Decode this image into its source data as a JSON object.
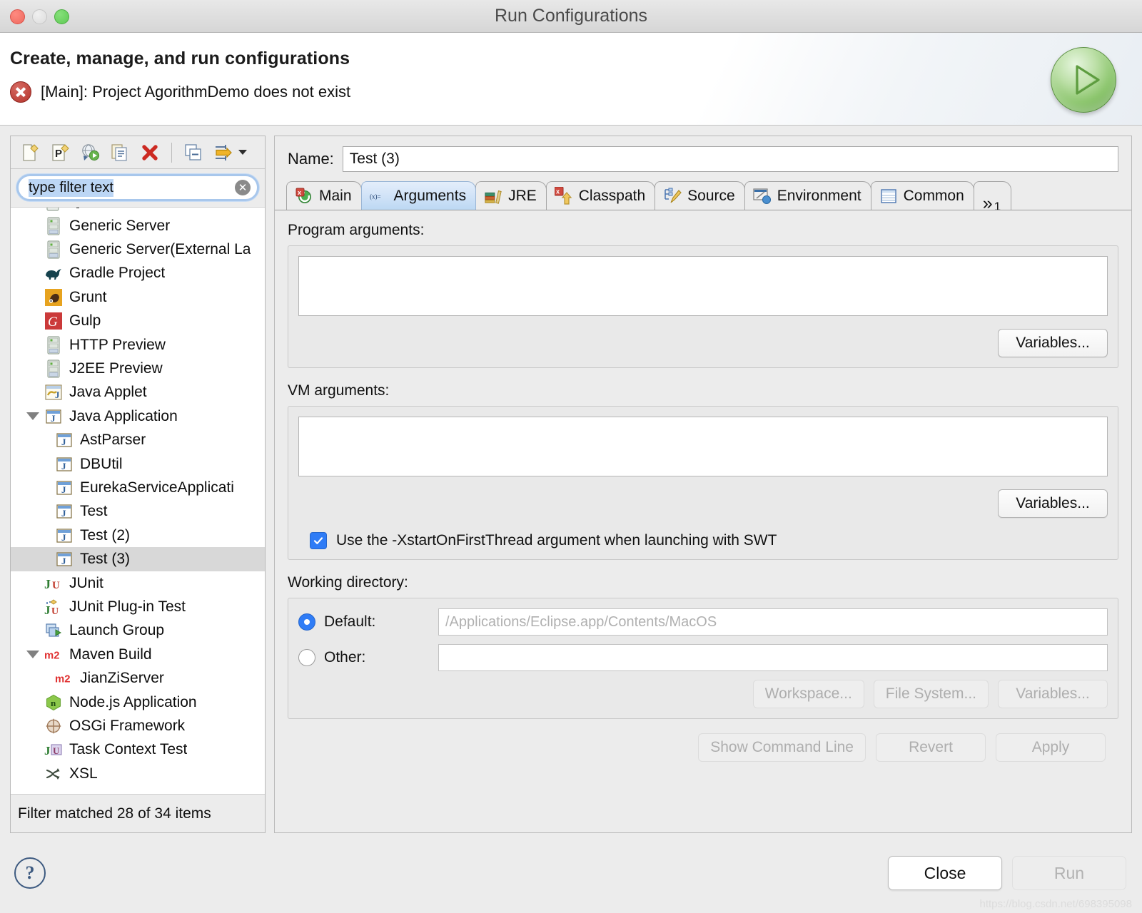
{
  "window": {
    "title": "Run Configurations",
    "traffic_lights": [
      "close",
      "minimize",
      "maximize"
    ]
  },
  "banner": {
    "title": "Create, manage, and run configurations",
    "error_message": "[Main]: Project AgorithmDemo does not exist",
    "error_icon": "error-circle-icon",
    "run_badge_icon": "run-play-icon"
  },
  "left_panel": {
    "toolbar": [
      {
        "name": "new-configuration-button",
        "icon": "new-launch-configuration-icon"
      },
      {
        "name": "new-prototype-button",
        "icon": "new-prototype-icon"
      },
      {
        "name": "export-button",
        "icon": "export-launch-configuration-icon"
      },
      {
        "name": "duplicate-button",
        "icon": "duplicate-configuration-icon"
      },
      {
        "name": "delete-button",
        "icon": "delete-red-x-icon"
      },
      {
        "name": "collapse-all-button",
        "icon": "collapse-all-icon"
      },
      {
        "name": "filter-menu-button",
        "icon": "filter-launch-configurations-icon"
      }
    ],
    "filter": {
      "value": "type filter text",
      "placeholder": "type filter text",
      "clear_icon": "clear-filter-icon"
    },
    "tree": [
      {
        "label": "Generic Server",
        "icon": "server-icon",
        "depth": 0,
        "twisty": "none",
        "selected": false
      },
      {
        "label": "Generic Server(External La",
        "icon": "server-icon",
        "depth": 0,
        "twisty": "none",
        "selected": false
      },
      {
        "label": "Gradle Project",
        "icon": "gradle-elephant-icon",
        "depth": 0,
        "twisty": "none",
        "selected": false
      },
      {
        "label": "Grunt",
        "icon": "grunt-icon",
        "depth": 0,
        "twisty": "none",
        "selected": false
      },
      {
        "label": "Gulp",
        "icon": "gulp-icon",
        "depth": 0,
        "twisty": "none",
        "selected": false
      },
      {
        "label": "HTTP Preview",
        "icon": "server-icon",
        "depth": 0,
        "twisty": "none",
        "selected": false
      },
      {
        "label": "J2EE Preview",
        "icon": "server-icon",
        "depth": 0,
        "twisty": "none",
        "selected": false
      },
      {
        "label": "Java Applet",
        "icon": "java-applet-icon",
        "depth": 0,
        "twisty": "none",
        "selected": false
      },
      {
        "label": "Java Application",
        "icon": "java-application-icon",
        "depth": 0,
        "twisty": "expanded",
        "selected": false
      },
      {
        "label": "AstParser",
        "icon": "java-application-icon",
        "depth": 1,
        "twisty": "none",
        "selected": false
      },
      {
        "label": "DBUtil",
        "icon": "java-application-icon",
        "depth": 1,
        "twisty": "none",
        "selected": false
      },
      {
        "label": "EurekaServiceApplicati",
        "icon": "java-application-icon",
        "depth": 1,
        "twisty": "none",
        "selected": false
      },
      {
        "label": "Test",
        "icon": "java-application-icon",
        "depth": 1,
        "twisty": "none",
        "selected": false
      },
      {
        "label": "Test (2)",
        "icon": "java-application-icon",
        "depth": 1,
        "twisty": "none",
        "selected": false
      },
      {
        "label": "Test (3)",
        "icon": "java-application-icon",
        "depth": 1,
        "twisty": "none",
        "selected": true
      },
      {
        "label": "JUnit",
        "icon": "junit-icon",
        "depth": 0,
        "twisty": "none",
        "selected": false
      },
      {
        "label": "JUnit Plug-in Test",
        "icon": "junit-plugin-icon",
        "depth": 0,
        "twisty": "none",
        "selected": false
      },
      {
        "label": "Launch Group",
        "icon": "launch-group-icon",
        "depth": 0,
        "twisty": "none",
        "selected": false
      },
      {
        "label": "Maven Build",
        "icon": "maven-icon",
        "depth": 0,
        "twisty": "expanded",
        "selected": false
      },
      {
        "label": "JianZiServer",
        "icon": "maven-icon",
        "depth": 1,
        "twisty": "none",
        "selected": false
      },
      {
        "label": "Node.js Application",
        "icon": "nodejs-icon",
        "depth": 0,
        "twisty": "none",
        "selected": false
      },
      {
        "label": "OSGi Framework",
        "icon": "osgi-icon",
        "depth": 0,
        "twisty": "none",
        "selected": false
      },
      {
        "label": "Task Context Test",
        "icon": "task-context-test-icon",
        "depth": 0,
        "twisty": "none",
        "selected": false
      },
      {
        "label": "XSL",
        "icon": "xsl-icon",
        "depth": 0,
        "twisty": "none",
        "selected": false
      }
    ],
    "status": "Filter matched 28 of 34 items"
  },
  "right_panel": {
    "name_label": "Name:",
    "name_value": "Test (3)",
    "tabs": [
      {
        "label": "Main",
        "icon": "main-launch-icon",
        "active": false
      },
      {
        "label": "Arguments",
        "icon": "arguments-variable-icon",
        "active": true
      },
      {
        "label": "JRE",
        "icon": "jre-books-icon",
        "active": false
      },
      {
        "label": "Classpath",
        "icon": "classpath-icon",
        "active": false
      },
      {
        "label": "Source",
        "icon": "source-pencil-icon",
        "active": false
      },
      {
        "label": "Environment",
        "icon": "environment-icon",
        "active": false
      },
      {
        "label": "Common",
        "icon": "common-table-icon",
        "active": false
      }
    ],
    "tab_overflow": {
      "chevron": "»",
      "count": "1"
    },
    "program_arguments": {
      "label": "Program arguments:",
      "value": "",
      "variables_button": "Variables..."
    },
    "vm_arguments": {
      "label": "VM arguments:",
      "value": "",
      "variables_button": "Variables..."
    },
    "swt_checkbox": {
      "label": "Use the -XstartOnFirstThread argument when launching with SWT",
      "checked": true
    },
    "working_directory": {
      "label": "Working directory:",
      "default_radio_label": "Default:",
      "default_selected": true,
      "default_path": "/Applications/Eclipse.app/Contents/MacOS",
      "other_radio_label": "Other:",
      "other_selected": false,
      "other_value": "",
      "buttons": [
        {
          "label": "Workspace...",
          "enabled": false
        },
        {
          "label": "File System...",
          "enabled": false
        },
        {
          "label": "Variables...",
          "enabled": false
        }
      ]
    },
    "action_buttons": [
      {
        "label": "Show Command Line",
        "enabled": false
      },
      {
        "label": "Revert",
        "enabled": false
      },
      {
        "label": "Apply",
        "enabled": false
      }
    ]
  },
  "footer": {
    "help_icon": "help-question-icon",
    "close_button": {
      "label": "Close",
      "enabled": true
    },
    "run_button": {
      "label": "Run",
      "enabled": false
    },
    "watermark": "https://blog.csdn.net/698395098"
  },
  "colors": {
    "accent_blue": "#2f7cf6",
    "tab_active": "#cfe2f7",
    "selection_gray": "#d8d8d8",
    "error_red": "#b5342c",
    "run_green": "#6aa84f"
  }
}
